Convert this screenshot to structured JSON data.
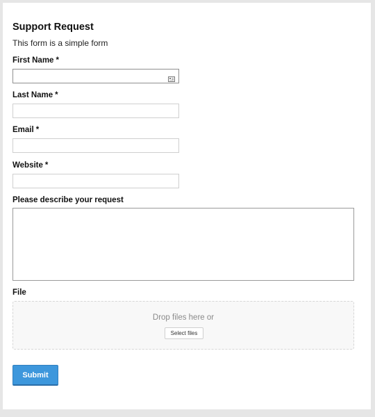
{
  "form": {
    "title": "Support Request",
    "subtitle": "This form is a simple form",
    "required_marker": "*",
    "fields": {
      "first_name": {
        "label": "First Name",
        "value": ""
      },
      "last_name": {
        "label": "Last Name",
        "value": ""
      },
      "email": {
        "label": "Email",
        "value": ""
      },
      "website": {
        "label": "Website",
        "value": ""
      },
      "request": {
        "label": "Please describe your request",
        "value": ""
      }
    },
    "file": {
      "label": "File",
      "drop_text": "Drop files here or",
      "select_label": "Select files"
    },
    "submit_label": "Submit"
  },
  "colors": {
    "accent": "#3d97dc",
    "background": "#e6e6e6",
    "card": "#ffffff"
  },
  "icons": {
    "autofill": "contact-card-icon"
  }
}
